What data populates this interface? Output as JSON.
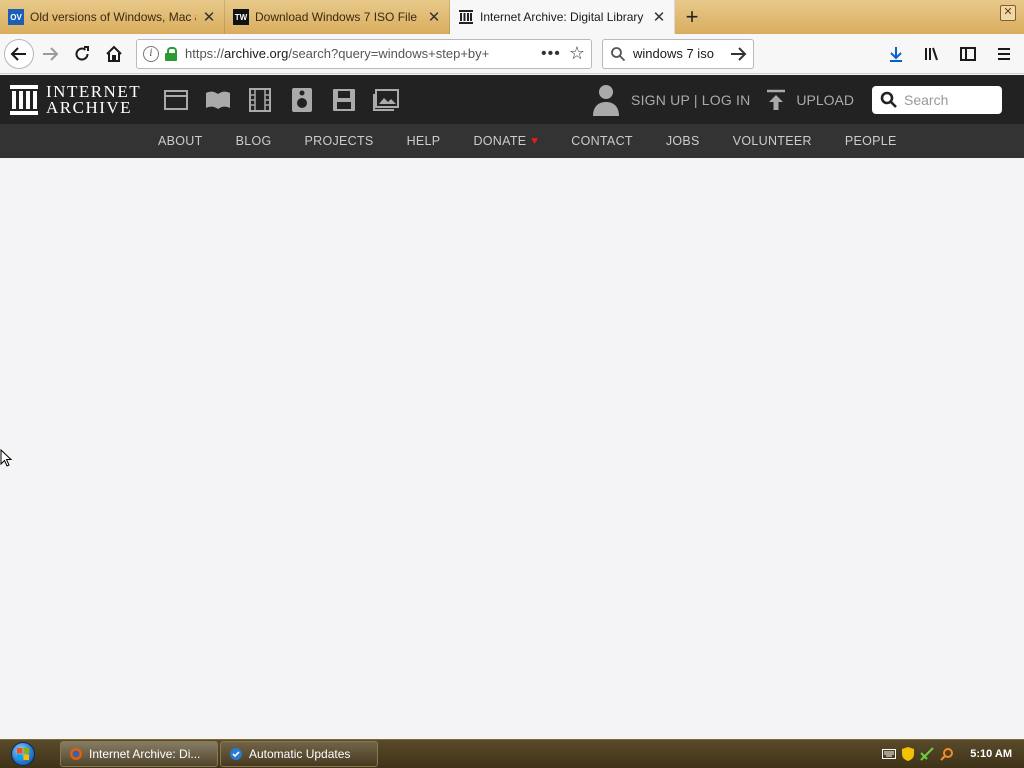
{
  "browser": {
    "tabs": [
      {
        "favicon_text": "OV",
        "favicon_color": "#1a5fb4",
        "title": "Old versions of Windows, Mac a",
        "active": false
      },
      {
        "favicon_text": "TW",
        "favicon_color": "#111111",
        "title": "Download Windows 7 ISO File",
        "active": false
      },
      {
        "favicon_text": "",
        "favicon_color": "#ffffff",
        "title": "Internet Archive: Digital Library",
        "active": true
      }
    ],
    "new_tab_symbol": "+",
    "window_close_symbol": "✕",
    "url_prefix": "https://",
    "url_host": "archive.org",
    "url_path": "/search?query=windows+step+by+",
    "search_value": "windows 7 iso"
  },
  "ia": {
    "logo_line1": "INTERNET",
    "logo_line2": "ARCHIVE",
    "media_icons": [
      "web-icon",
      "texts-icon",
      "video-icon",
      "audio-icon",
      "software-icon",
      "images-icon"
    ],
    "account_links": "SIGN UP | LOG IN",
    "upload_label": "UPLOAD",
    "search_placeholder": "Search",
    "subnav": [
      "ABOUT",
      "BLOG",
      "PROJECTS",
      "HELP",
      "DONATE",
      "CONTACT",
      "JOBS",
      "VOLUNTEER",
      "PEOPLE"
    ],
    "donate_heart": "♥"
  },
  "taskbar": {
    "buttons": [
      "Internet Archive: Di...",
      "Automatic Updates"
    ],
    "clock": "5:10 AM"
  },
  "colors": {
    "tabstrip": "#d9ad5e",
    "ia_header": "#222222",
    "ia_subnav": "#333333",
    "content_bg": "#f4f4f7"
  }
}
